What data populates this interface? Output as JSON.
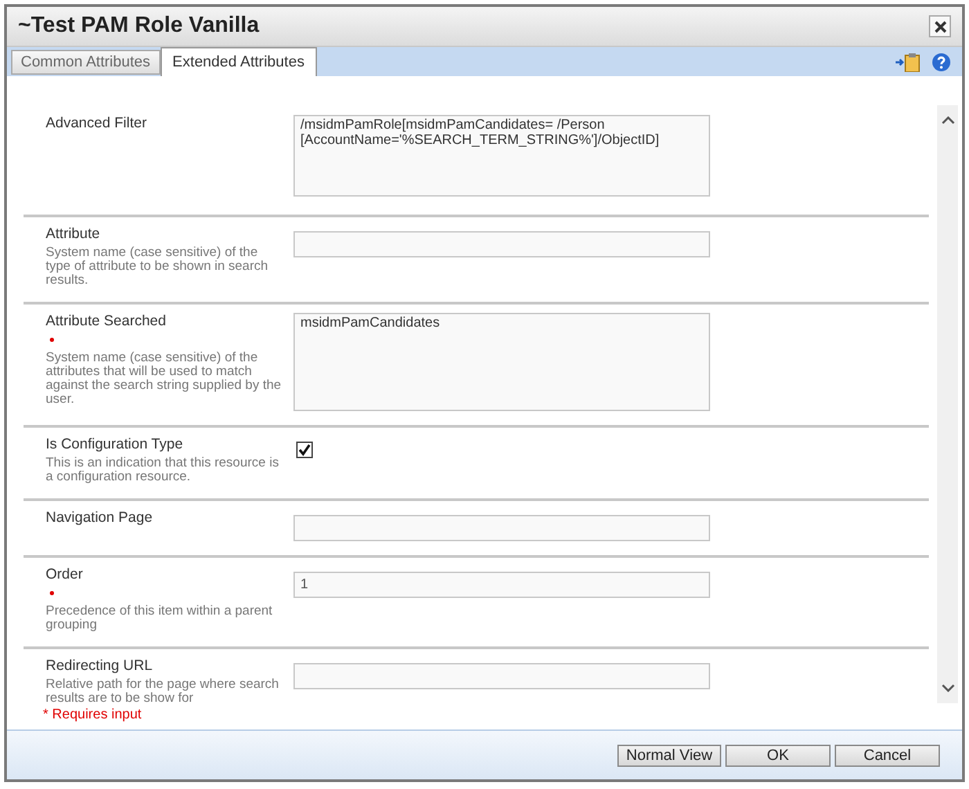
{
  "window": {
    "title": "~Test PAM Role Vanilla"
  },
  "tabs": [
    {
      "label": "Common Attributes",
      "selected": false
    },
    {
      "label": "Extended Attributes",
      "selected": true
    }
  ],
  "fields": [
    {
      "kind": "textarea",
      "label": "Advanced Filter",
      "required": false,
      "value": "/msidmPamRole[msidmPamCandidates= /Person [AccountName='%SEARCH_TERM_STRING%']/ObjectID]"
    },
    {
      "kind": "input",
      "label": "Attribute",
      "required": false,
      "description": "System name (case sensitive) of the type of attribute to be shown in search results."
    },
    {
      "kind": "textarea",
      "label": "Attribute Searched",
      "required": true,
      "description": "System name (case sensitive) of the attributes that will be used to match against the search string supplied by the user.",
      "value": "msidmPamCandidates"
    },
    {
      "kind": "checkbox",
      "label": "Is Configuration Type",
      "required": false,
      "description": "This is an indication that this resource is a configuration resource.",
      "checked": true
    },
    {
      "kind": "input",
      "label": "Navigation Page",
      "required": false
    },
    {
      "kind": "input",
      "label": "Order",
      "required": true,
      "description": "Precedence of this item within a parent grouping",
      "value": "1"
    },
    {
      "kind": "input",
      "label": "Redirecting URL",
      "required": false,
      "description": "Relative path for the page where search results are to be show for"
    }
  ],
  "required_note": "* Requires input",
  "buttons": [
    "Normal View",
    "OK",
    "Cancel"
  ]
}
